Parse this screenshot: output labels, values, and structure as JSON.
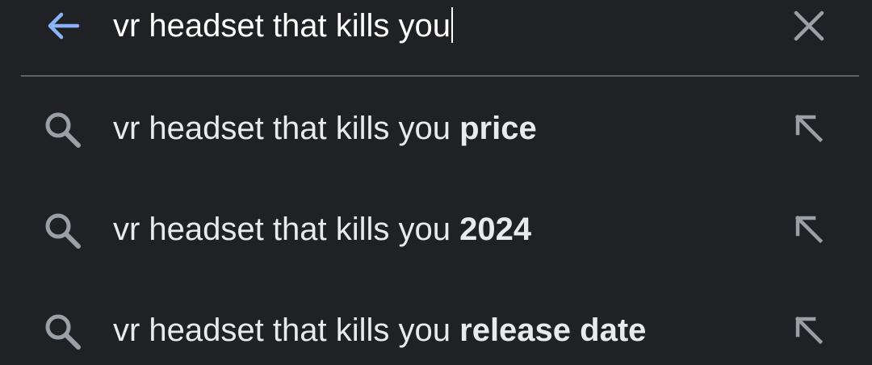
{
  "search": {
    "query": "vr headset that kills you",
    "back_icon": "arrow-back-icon",
    "clear_icon": "close-icon",
    "accent_color": "#8ab4f8"
  },
  "suggestions": [
    {
      "prefix": "vr headset that kills you",
      "completion": "price",
      "icon": "search-icon",
      "action_icon": "arrow-up-left-icon"
    },
    {
      "prefix": "vr headset that kills you",
      "completion": "2024",
      "icon": "search-icon",
      "action_icon": "arrow-up-left-icon"
    },
    {
      "prefix": "vr headset that kills you",
      "completion": "release date",
      "icon": "search-icon",
      "action_icon": "arrow-up-left-icon"
    }
  ],
  "colors": {
    "background": "#202124",
    "text": "#e8eaed",
    "icon": "#9aa0a6",
    "divider": "#5f6368"
  }
}
